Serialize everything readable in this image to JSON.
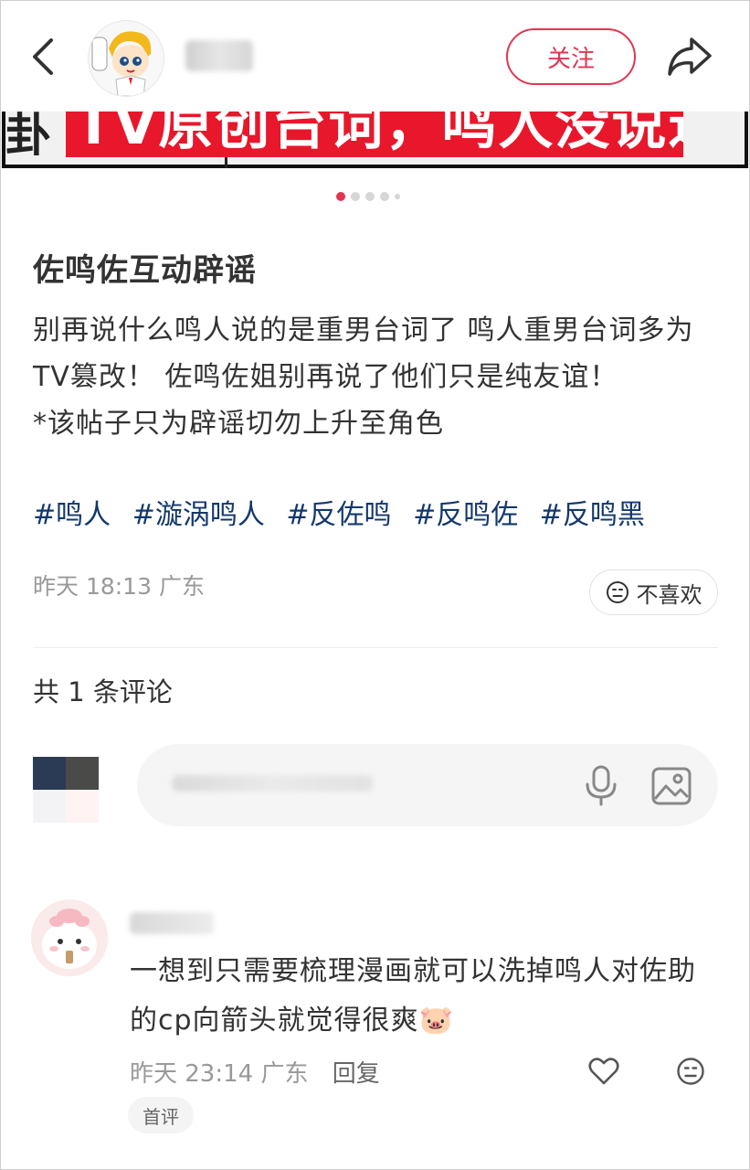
{
  "header": {
    "follow_label": "关注"
  },
  "banner": {
    "left_text": "卦",
    "main_text": "TV原创台词，鸣人没说过"
  },
  "carousel": {
    "count": 5,
    "active_index": 0
  },
  "post": {
    "title": "佐鸣佐互动辟谣",
    "body_lines": [
      "别再说什么鸣人说的是重男台词了 鸣人重男台词多为TV篡改！ 佐鸣佐姐别再说了他们只是纯友谊！",
      "*该帖子只为辟谣切勿上升至角色"
    ],
    "tags": [
      "#鸣人",
      "#漩涡鸣人",
      "#反佐鸣",
      "#反鸣佐",
      "#反鸣黑"
    ],
    "time": "昨天 18:13",
    "location": "广东",
    "dislike_label": "不喜欢"
  },
  "comments_section": {
    "count_label": "共 1 条评论"
  },
  "comment": {
    "text": "一想到只需要梳理漫画就可以洗掉鸣人对佐助的cp向箭头就觉得很爽",
    "emoji": "🐷",
    "time": "昨天 23:14",
    "location": "广东",
    "reply_label": "回复",
    "badge": "首评"
  },
  "colors": {
    "accent": "#e33552",
    "tag": "#13386c",
    "muted": "#999999"
  }
}
